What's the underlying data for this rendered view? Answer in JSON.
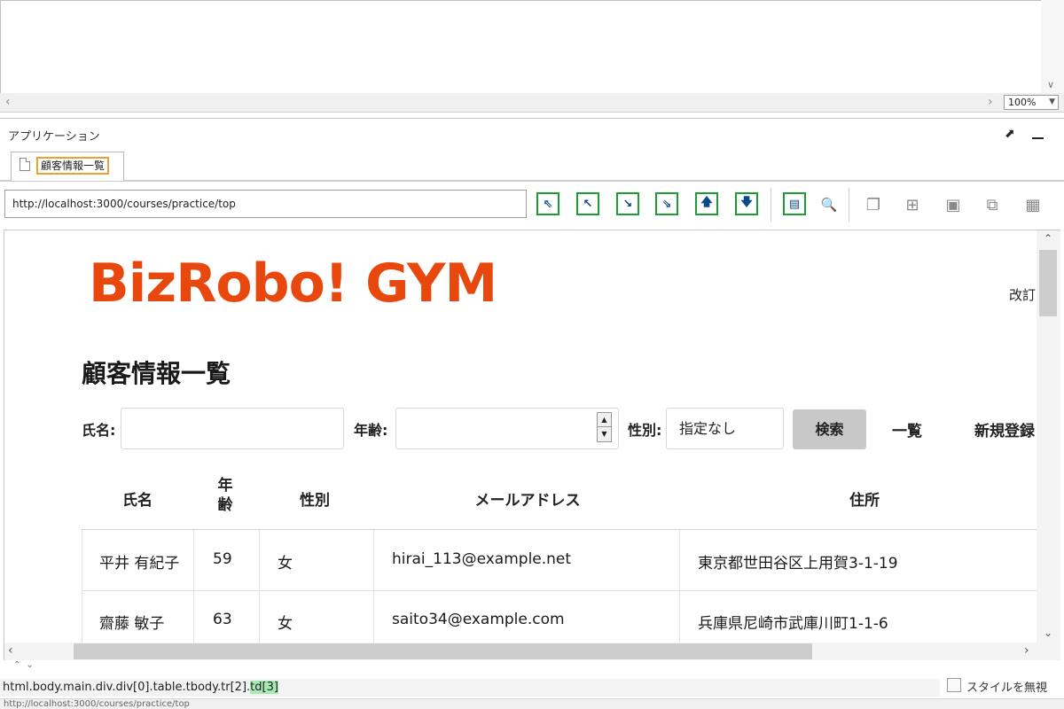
{
  "top": {
    "zoom": "100%"
  },
  "app_panel": {
    "title": "アプリケーション"
  },
  "tabs": [
    {
      "label": "顧客情報一覧"
    }
  ],
  "address": {
    "url": "http://localhost:3000/courses/practice/top"
  },
  "page": {
    "logo": "BizRobo! GYM",
    "revise_link": "改訂",
    "title": "顧客情報一覧",
    "form": {
      "name_label": "氏名:",
      "name_value": "",
      "age_label": "年齢:",
      "age_value": "",
      "gender_label": "性別:",
      "gender_selected": "指定なし",
      "search_label": "検索",
      "list_link": "一覧",
      "register_link": "新規登録"
    },
    "table": {
      "headers": {
        "name": "氏名",
        "age": "年齢",
        "gender": "性別",
        "email": "メールアドレス",
        "address": "住所"
      },
      "rows": [
        {
          "name": "平井 有紀子",
          "age": "59",
          "gender": "女",
          "email": "hirai_113@example.net",
          "address": "東京都世田谷区上用賀3-1-19"
        },
        {
          "name": "齋藤 敏子",
          "age": "63",
          "gender": "女",
          "email": "saito34@example.com",
          "address": "兵庫県尼崎市武庫川町1-1-6"
        }
      ]
    }
  },
  "bottom": {
    "path_prefix": "html.body.main.div.div[0].table.tbody.tr[2].",
    "path_highlight": "td[3]",
    "ignore_style_label": "スタイルを無視",
    "status_text": "http://localhost:3000/courses/practice/top"
  },
  "colors": {
    "logo": "#e8470d",
    "toolbar_border": "#1e9c34",
    "tab_highlight": "#f0a030",
    "path_highlight": "#a7e8b5"
  }
}
